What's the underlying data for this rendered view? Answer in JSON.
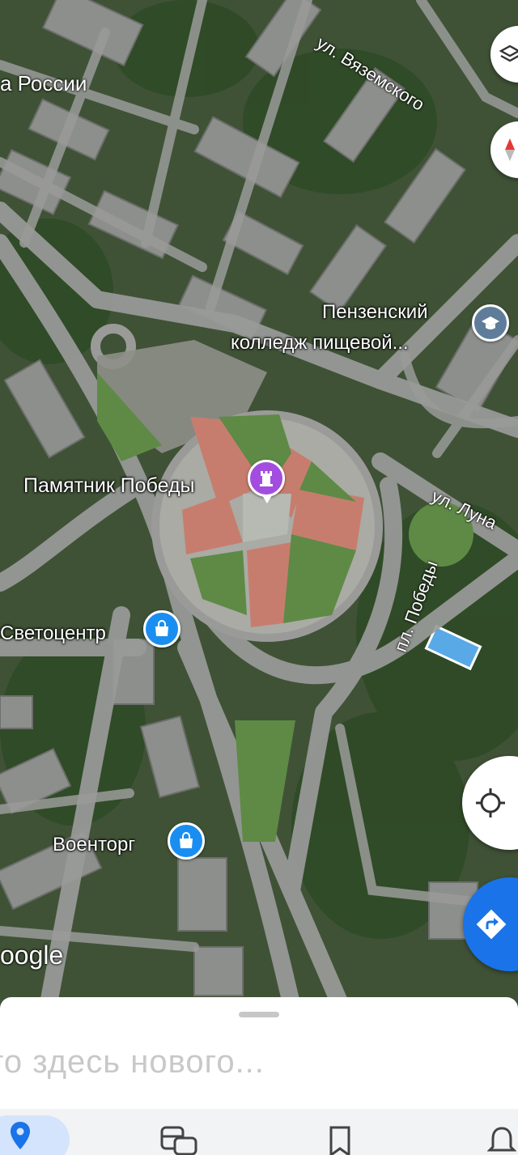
{
  "map": {
    "street_labels": {
      "russia": "а России",
      "vyazemskogo": "ул. Вяземского",
      "lunacharskogo": "ул. Луна",
      "pobedy_square": "пл. Победы"
    },
    "pois": {
      "college_line1": "Пензенский",
      "college_line2": "колледж пищевой...",
      "monument": "Памятник Победы",
      "svetocentr": "Светоцентр",
      "voentorg": "Военторг"
    },
    "icons": {
      "college": "school-icon",
      "monument": "monument-icon",
      "shop": "shopping-bag-icon"
    },
    "colors": {
      "school_pin": "#5f7d9b",
      "monument_pin": "#a24de0",
      "shop_pin": "#1a8ef0",
      "directions": "#1a73e8"
    },
    "google_logo": "oogle"
  },
  "sheet": {
    "placeholder": "то здесь нового..."
  },
  "nav": {
    "items": [
      {
        "name": "explore",
        "icon": "location-pin-icon",
        "active": true
      },
      {
        "name": "commute",
        "icon": "commute-icon"
      },
      {
        "name": "saved",
        "icon": "bookmark-icon"
      },
      {
        "name": "updates",
        "icon": "bell-icon"
      }
    ]
  }
}
